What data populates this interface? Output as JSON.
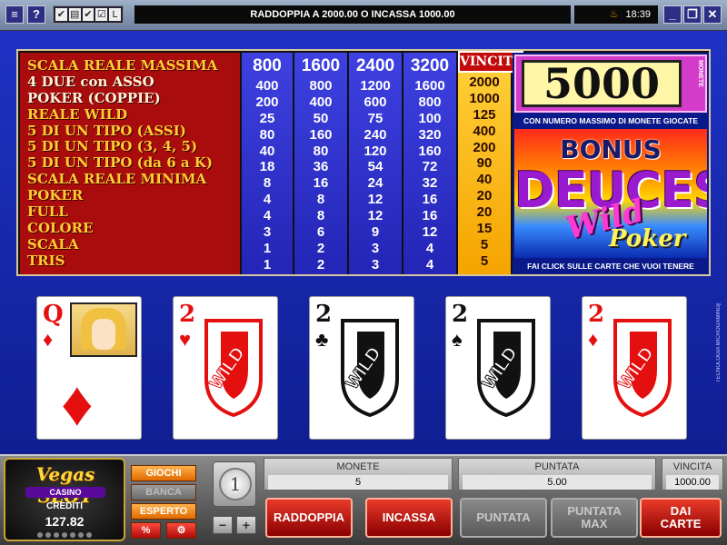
{
  "titlebar": {
    "message": "RADDOPPIA A 2000.00 O INCASSA 1000.00",
    "time": "18:39",
    "left_icons": [
      "menu-icon",
      "help-icon"
    ],
    "toolbar_icons": [
      "check-icon",
      "stats-icon",
      "check-icon",
      "check-icon",
      "L"
    ],
    "window_buttons": [
      "minimize-icon",
      "restore-icon",
      "close-icon"
    ]
  },
  "paytable": {
    "hands": [
      "SCALA REALE MASSIMA",
      "4 DUE con ASSO",
      "POKER (COPPIE)",
      "REALE WILD",
      "5 DI UN TIPO (ASSI)",
      "5 DI UN TIPO (3, 4, 5)",
      "5 DI UN TIPO (da 6 a K)",
      "SCALA REALE MINIMA",
      "POKER",
      "FULL",
      "COLORE",
      "SCALA",
      "TRIS"
    ],
    "columns": [
      {
        "header": "",
        "values": [
          "800",
          "400",
          "200",
          "25",
          "80",
          "40",
          "18",
          "8",
          "4",
          "4",
          "3",
          "1",
          "1"
        ]
      },
      {
        "header": "",
        "values": [
          "1600",
          "800",
          "400",
          "50",
          "160",
          "80",
          "36",
          "16",
          "8",
          "8",
          "6",
          "2",
          "2"
        ]
      },
      {
        "header": "",
        "values": [
          "2400",
          "1200",
          "600",
          "75",
          "240",
          "120",
          "54",
          "24",
          "12",
          "12",
          "9",
          "3",
          "3"
        ]
      },
      {
        "header": "",
        "values": [
          "3200",
          "1600",
          "800",
          "100",
          "320",
          "160",
          "72",
          "32",
          "16",
          "16",
          "12",
          "4",
          "4"
        ]
      }
    ],
    "win_header": "VINCITE",
    "win_values": [
      "2000",
      "1000",
      "125",
      "400",
      "200",
      "90",
      "40",
      "20",
      "20",
      "15",
      "5",
      "5"
    ]
  },
  "promo": {
    "jackpot": "5000",
    "jackpot_unit": "MONETE",
    "subtitle": "CON NUMERO MASSIMO DI MONETE GIOCATE",
    "logo_bonus": "BONUS",
    "logo_deuces": "DEUCES",
    "logo_wild": "Wild",
    "logo_poker": "Poker",
    "footer": "FAI CLICK SULLE CARTE CHE VUOI TENERE"
  },
  "cards": [
    {
      "rank": "Q",
      "suit": "♦",
      "color": "red",
      "wild": false
    },
    {
      "rank": "2",
      "suit": "♥",
      "color": "red",
      "wild": true
    },
    {
      "rank": "2",
      "suit": "♣",
      "color": "black",
      "wild": true
    },
    {
      "rank": "2",
      "suit": "♠",
      "color": "black",
      "wild": true
    },
    {
      "rank": "2",
      "suit": "♦",
      "color": "red",
      "wild": true
    }
  ],
  "wild_text": "WILD",
  "side_credit": "TECNOLOGIA MICROGAMING™",
  "casino": {
    "brand": "Vegas SLOT",
    "sub": "CASINO",
    "credits_label": "CREDITI",
    "credits_value": "127.82"
  },
  "side_buttons": {
    "giochi": "GIOCHI",
    "banca": "BANCA",
    "esperto": "ESPERTO",
    "percent": "%",
    "options_icon": "options-icon"
  },
  "coin": {
    "value": "1",
    "minus": "−",
    "plus": "+"
  },
  "info": {
    "monete_label": "MONETE",
    "monete_value": "5",
    "puntata_label": "PUNTATA",
    "puntata_value": "5.00",
    "vincita_label": "VINCITA",
    "vincita_value": "1000.00"
  },
  "actions": {
    "raddoppia": "RADDOPPIA",
    "incassa": "INCASSA",
    "puntata": "PUNTATA",
    "puntata_max": "PUNTATA MAX",
    "dai_carte": "DAI CARTE"
  }
}
